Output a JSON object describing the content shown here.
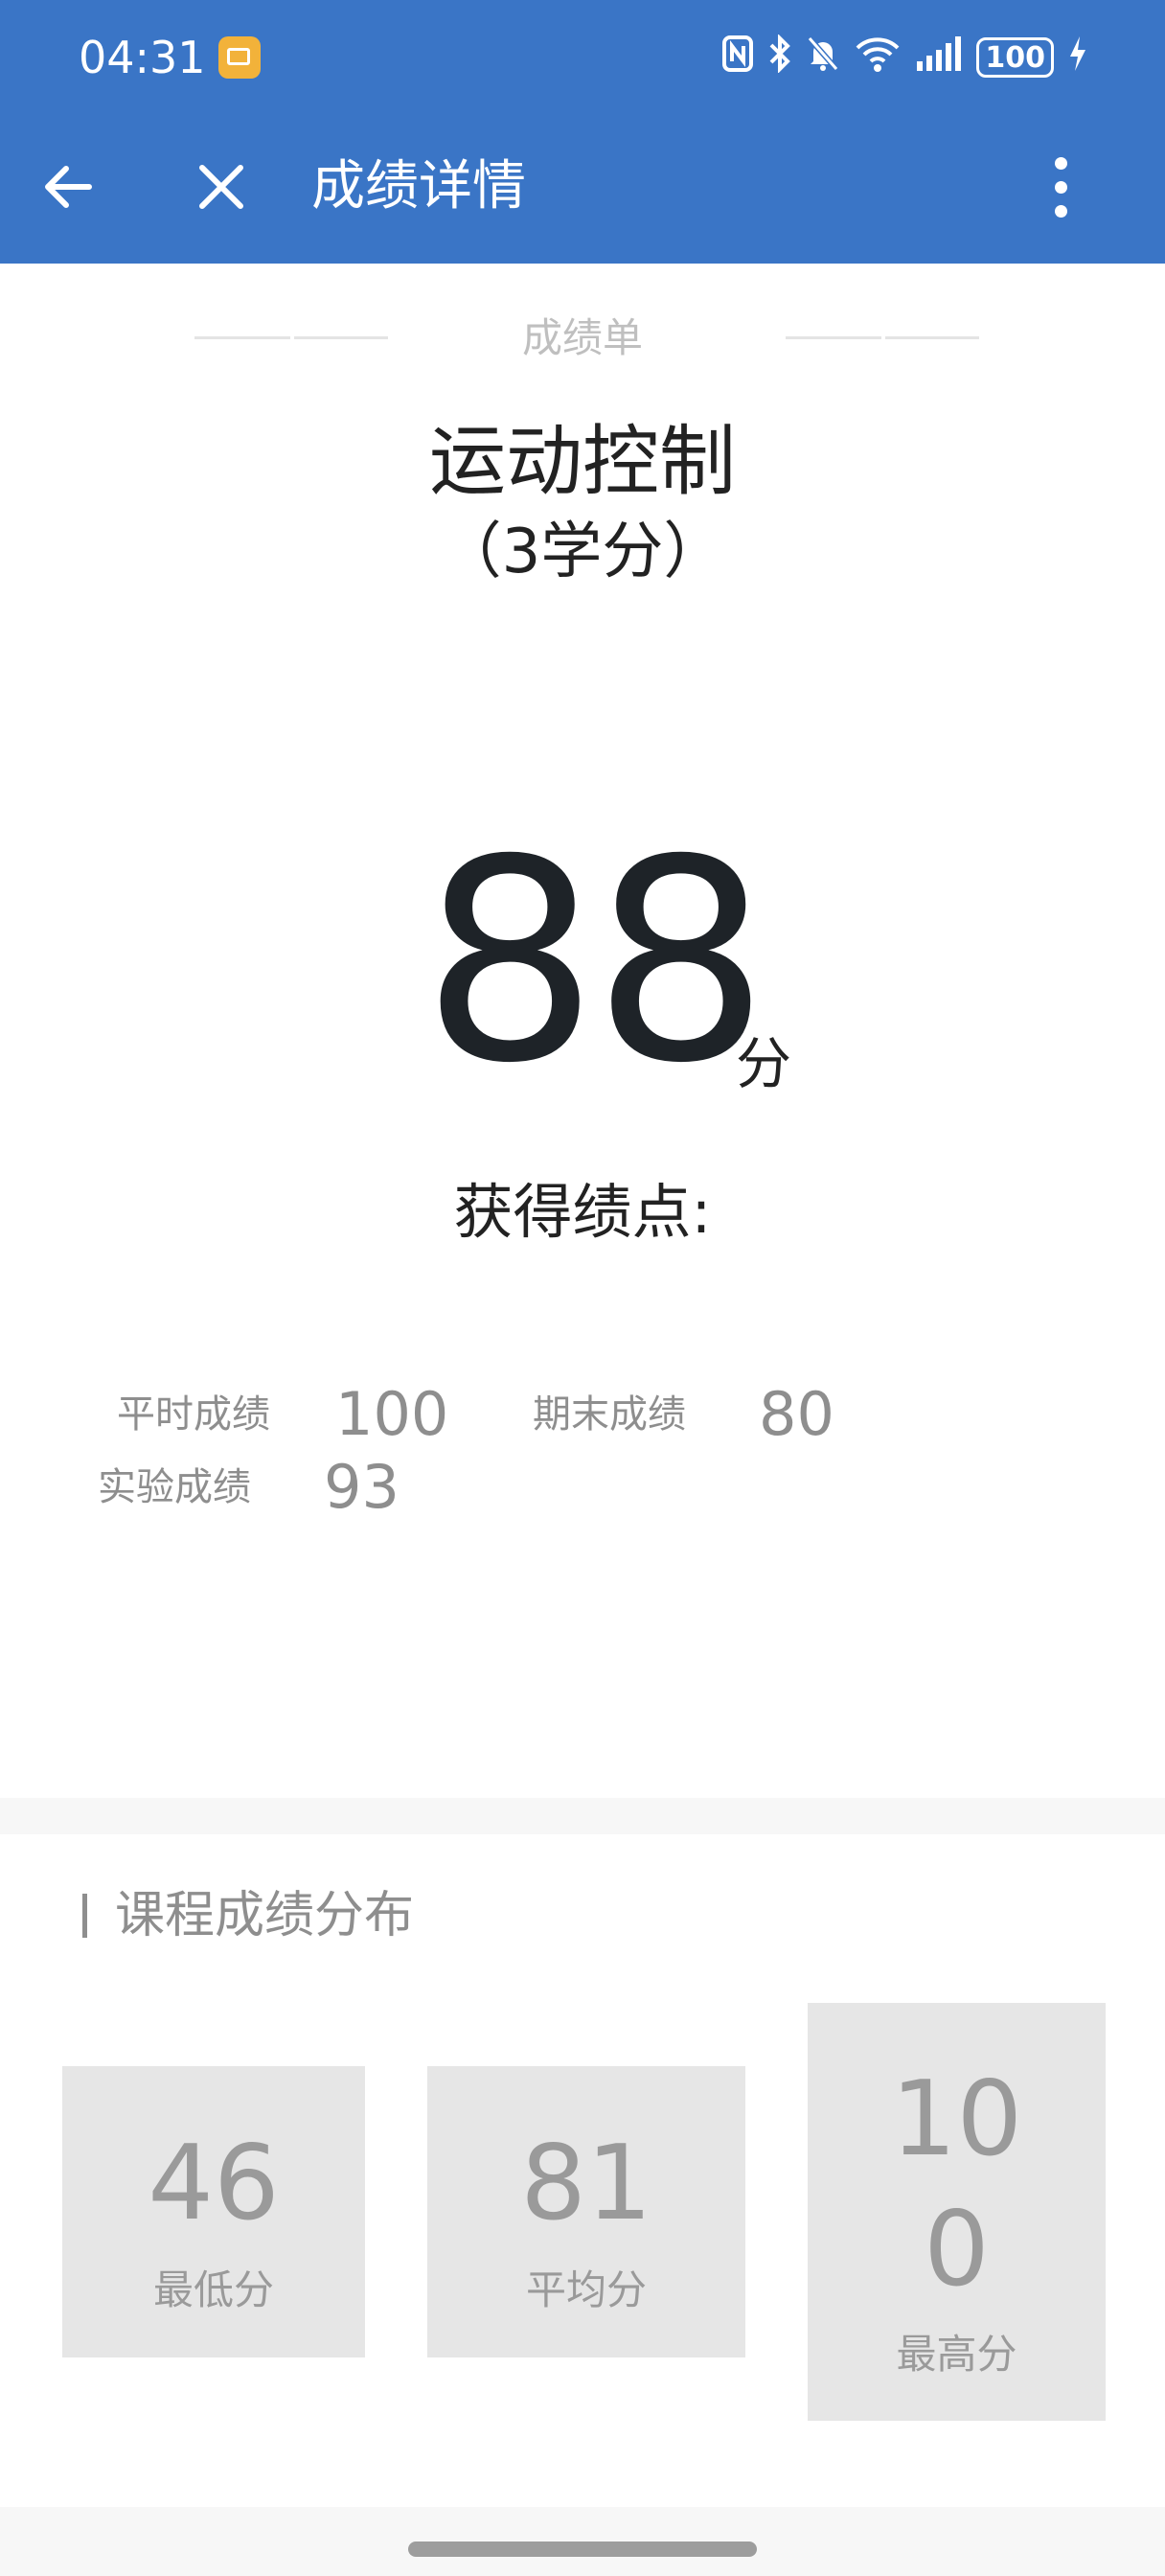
{
  "status_bar": {
    "time": "04:31",
    "battery": "100"
  },
  "app_bar": {
    "title": "成绩详情"
  },
  "report": {
    "label": "成绩单",
    "course_name": "运动控制",
    "credit": "（3学分）",
    "score": "88",
    "score_unit": "分",
    "gpa_label": "获得绩点:"
  },
  "components": [
    {
      "label": "平时成绩",
      "value": "100"
    },
    {
      "label": "期末成绩",
      "value": "80"
    },
    {
      "label": "实验成绩",
      "value": "93"
    }
  ],
  "distribution": {
    "title": "课程成绩分布",
    "items": [
      {
        "value": "46",
        "label": "最低分"
      },
      {
        "value": "81",
        "label": "平均分"
      },
      {
        "value_line1": "10",
        "value_line2": "0",
        "label": "最高分"
      }
    ]
  },
  "colors": {
    "app_bar": "#3a75c6",
    "box": "#e6e6e6",
    "muted_text": "#8e8e8e"
  }
}
